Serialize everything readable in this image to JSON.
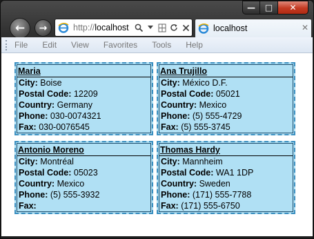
{
  "window": {
    "caption": {
      "minimize": "—",
      "maximize": "□",
      "close": "✕"
    }
  },
  "nav": {
    "back": "←",
    "forward": "→"
  },
  "address": {
    "protocol": "http://",
    "host": "localhost"
  },
  "tab": {
    "title": "localhost",
    "close": "✕"
  },
  "menu": [
    "File",
    "Edit",
    "View",
    "Favorites",
    "Tools",
    "Help"
  ],
  "labels": {
    "city": "City:",
    "postal": "Postal Code:",
    "country": "Country:",
    "phone": "Phone:",
    "fax": "Fax:"
  },
  "customers": [
    {
      "name": "Maria",
      "city": "Boise",
      "postal": "12209",
      "country": "Germany",
      "phone": "030-0074321",
      "fax": "030-0076545"
    },
    {
      "name": "Ana Trujillo",
      "city": "México D.F.",
      "postal": "05021",
      "country": "Mexico",
      "phone": "(5) 555-4729",
      "fax": "(5) 555-3745"
    },
    {
      "name": "Antonio Moreno",
      "city": "Montréal",
      "postal": "05023",
      "country": "Mexico",
      "phone": "(5) 555-3932",
      "fax": ""
    },
    {
      "name": "Thomas Hardy",
      "city": "Mannheim",
      "postal": "WA1 1DP",
      "country": "Sweden",
      "phone": "(171) 555-7788",
      "fax": "(171) 555-6750"
    }
  ],
  "colors": {
    "card_bg": "#b0e0f4",
    "card_border": "#3a8fc0",
    "close_button": "#c43a22"
  }
}
